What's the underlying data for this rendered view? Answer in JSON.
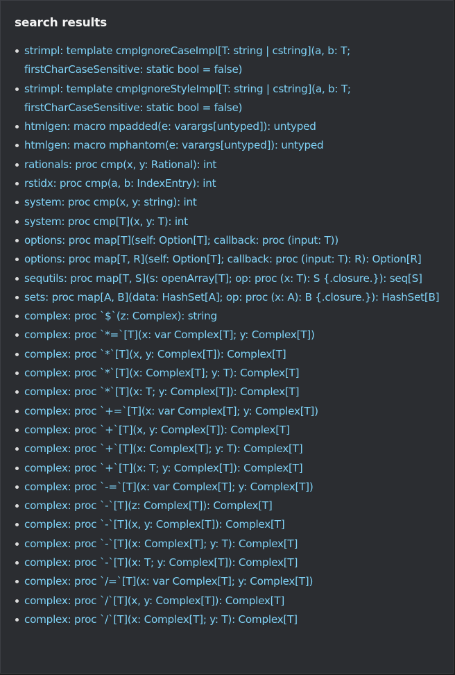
{
  "panel": {
    "title": "search results"
  },
  "results": [
    "strimpl: template cmpIgnoreCaseImpl[T: string | cstring](a, b: T; firstCharCaseSensitive: static bool = false)",
    "strimpl: template cmpIgnoreStyleImpl[T: string | cstring](a, b: T; firstCharCaseSensitive: static bool = false)",
    "htmlgen: macro mpadded(e: varargs[untyped]): untyped",
    "htmlgen: macro mphantom(e: varargs[untyped]): untyped",
    "rationals: proc cmp(x, y: Rational): int",
    "rstidx: proc cmp(a, b: IndexEntry): int",
    "system: proc cmp(x, y: string): int",
    "system: proc cmp[T](x, y: T): int",
    "options: proc map[T](self: Option[T]; callback: proc (input: T))",
    "options: proc map[T, R](self: Option[T]; callback: proc (input: T): R): Option[R]",
    "sequtils: proc map[T, S](s: openArray[T]; op: proc (x: T): S {.closure.}): seq[S]",
    "sets: proc map[A, B](data: HashSet[A]; op: proc (x: A): B {.closure.}): HashSet[B]",
    "complex: proc `$`(z: Complex): string",
    "complex: proc `*=`[T](x: var Complex[T]; y: Complex[T])",
    "complex: proc `*`[T](x, y: Complex[T]): Complex[T]",
    "complex: proc `*`[T](x: Complex[T]; y: T): Complex[T]",
    "complex: proc `*`[T](x: T; y: Complex[T]): Complex[T]",
    "complex: proc `+=`[T](x: var Complex[T]; y: Complex[T])",
    "complex: proc `+`[T](x, y: Complex[T]): Complex[T]",
    "complex: proc `+`[T](x: Complex[T]; y: T): Complex[T]",
    "complex: proc `+`[T](x: T; y: Complex[T]): Complex[T]",
    "complex: proc `-=`[T](x: var Complex[T]; y: Complex[T])",
    "complex: proc `-`[T](z: Complex[T]): Complex[T]",
    "complex: proc `-`[T](x, y: Complex[T]): Complex[T]",
    "complex: proc `-`[T](x: Complex[T]; y: T): Complex[T]",
    "complex: proc `-`[T](x: T; y: Complex[T]): Complex[T]",
    "complex: proc `/=`[T](x: var Complex[T]; y: Complex[T])",
    "complex: proc `/`[T](x, y: Complex[T]): Complex[T]",
    "complex: proc `/`[T](x: Complex[T]; y: T): Complex[T]"
  ],
  "colors": {
    "background": "#2b2d31",
    "link": "#7fd3f7",
    "title": "#f2f2f2",
    "bullet": "#dcdcdc"
  }
}
